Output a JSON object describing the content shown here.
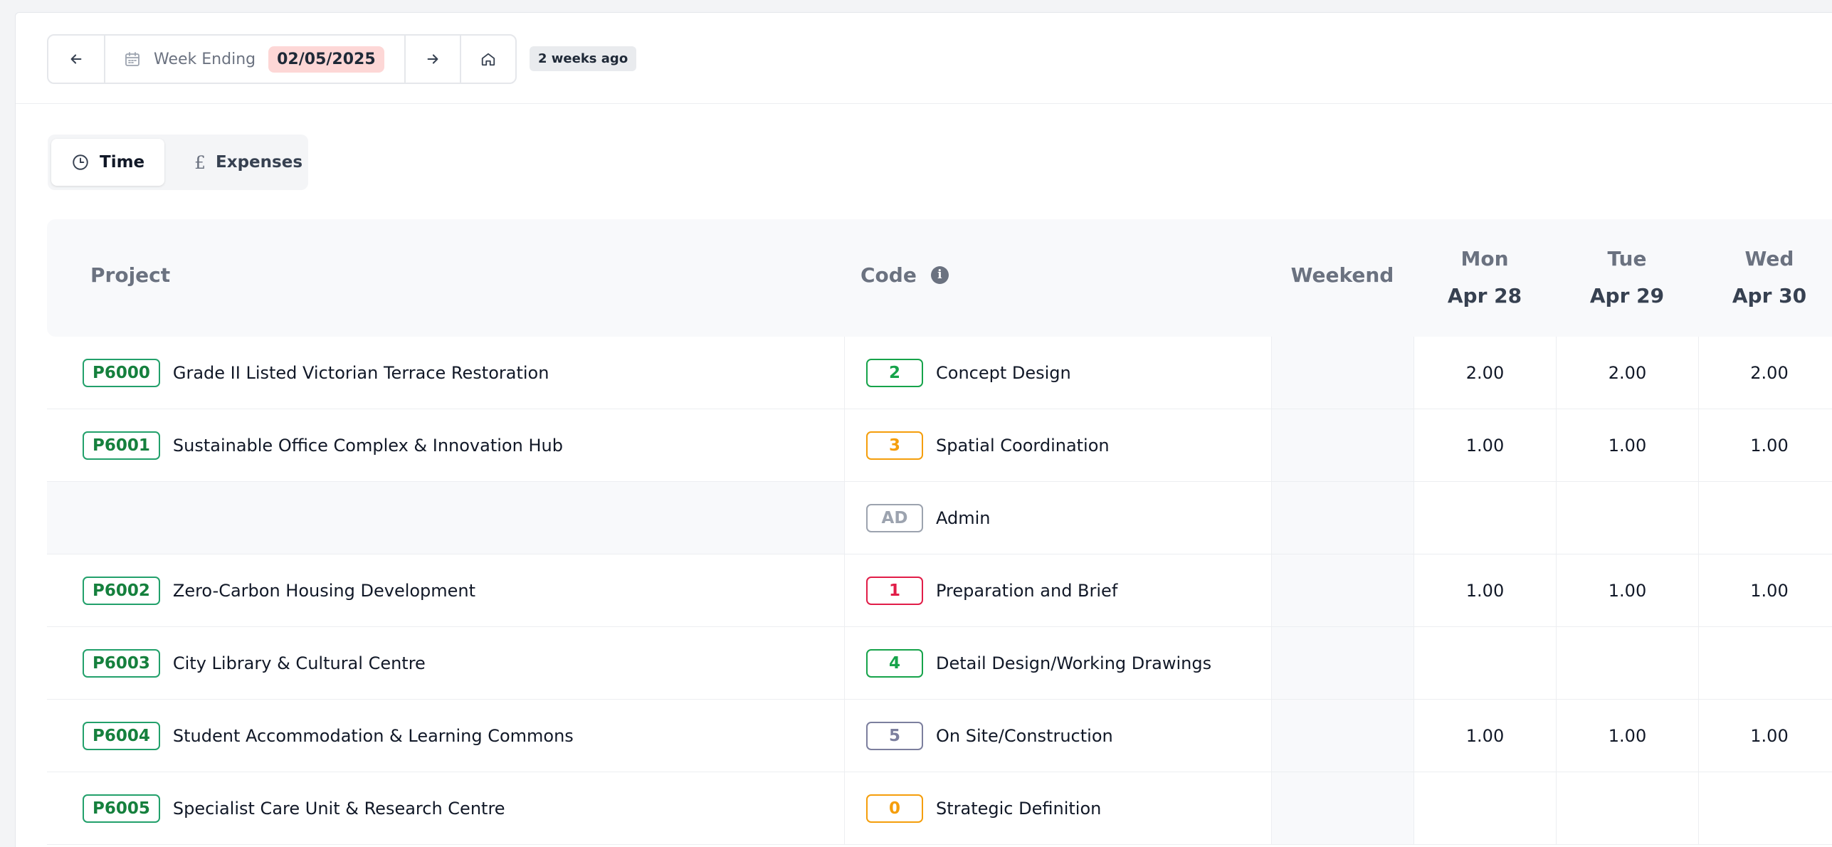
{
  "header": {
    "week_label": "Week Ending",
    "week_date": "02/05/2025",
    "relative": "2 weeks ago"
  },
  "tabs": [
    {
      "label": "Time",
      "icon": "clock-icon",
      "active": true
    },
    {
      "label": "Expenses",
      "icon": "pound-icon",
      "active": false
    }
  ],
  "table": {
    "col_project": "Project",
    "col_code": "Code",
    "col_weekend": "Weekend",
    "days": [
      {
        "day": "Mon",
        "date": "Apr 28"
      },
      {
        "day": "Tue",
        "date": "Apr 29"
      },
      {
        "day": "Wed",
        "date": "Apr 30"
      }
    ],
    "rows": [
      {
        "project_code": "P6000",
        "project_name": "Grade II Listed Victorian Terrace Restoration",
        "code": "2",
        "code_color": "#16a34a",
        "code_name": "Concept Design",
        "hours": [
          "2.00",
          "2.00",
          "2.00"
        ]
      },
      {
        "project_code": "P6001",
        "project_name": "Sustainable Office Complex & Innovation Hub",
        "code": "3",
        "code_color": "#f59e0b",
        "code_name": "Spatial Coordination",
        "hours": [
          "1.00",
          "1.00",
          "1.00"
        ]
      },
      {
        "project_code": "",
        "project_name": "",
        "code": "AD",
        "code_color": "#9ca3af",
        "code_name": "Admin",
        "hours": [
          "",
          "",
          ""
        ]
      },
      {
        "project_code": "P6002",
        "project_name": "Zero-Carbon Housing Development",
        "code": "1",
        "code_color": "#e11d48",
        "code_name": "Preparation and Brief",
        "hours": [
          "1.00",
          "1.00",
          "1.00"
        ]
      },
      {
        "project_code": "P6003",
        "project_name": "City Library & Cultural Centre",
        "code": "4",
        "code_color": "#16a34a",
        "code_name": "Detail Design/Working Drawings",
        "hours": [
          "",
          "",
          ""
        ]
      },
      {
        "project_code": "P6004",
        "project_name": "Student Accommodation & Learning Commons",
        "code": "5",
        "code_color": "#7c7f9e",
        "code_name": "On Site/Construction",
        "hours": [
          "1.00",
          "1.00",
          "1.00"
        ]
      },
      {
        "project_code": "P6005",
        "project_name": "Specialist Care Unit & Research Centre",
        "code": "0",
        "code_color": "#f59e0b",
        "code_name": "Strategic Definition",
        "hours": [
          "",
          "",
          ""
        ]
      }
    ]
  }
}
